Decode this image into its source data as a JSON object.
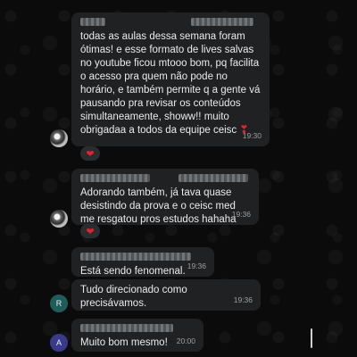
{
  "messages": [
    {
      "text": "todas as aulas dessa semana foram ótimas! e esse formato de lives salvas no youtube ficou mtooo bom, pq facilita o acesso pra quem não pode no horário, e também permite q a gente vá pausando pra revisar os conteúdos simultaneamente, showw!! muito obrigadaa a todos da equipe ceisc",
      "time": "19:30",
      "inline_emoji": "heart",
      "reaction": "heart"
    },
    {
      "text": "Adorando também, já tava quase desistindo da prova e o ceisc med me resgatou pros estudos hahaha",
      "time": "19:36",
      "reaction": "heart"
    },
    {
      "text": "Está sendo fenomenal.",
      "time": "19:36"
    },
    {
      "text": "Tudo direcionado como precisávamos.",
      "time": "19:36",
      "avatar_initial": "R"
    },
    {
      "text": "Muito bom mesmo!",
      "time": "20:00",
      "avatar_initial": "A"
    }
  ],
  "colors": {
    "background": "#0b0b0b",
    "bubble": "#1f2123",
    "text": "#e9ecee",
    "timestamp": "#9aa0a4",
    "heart": "#e0222e",
    "avatar_r": "#1f5d5a",
    "avatar_a": "#3b3a8a"
  }
}
